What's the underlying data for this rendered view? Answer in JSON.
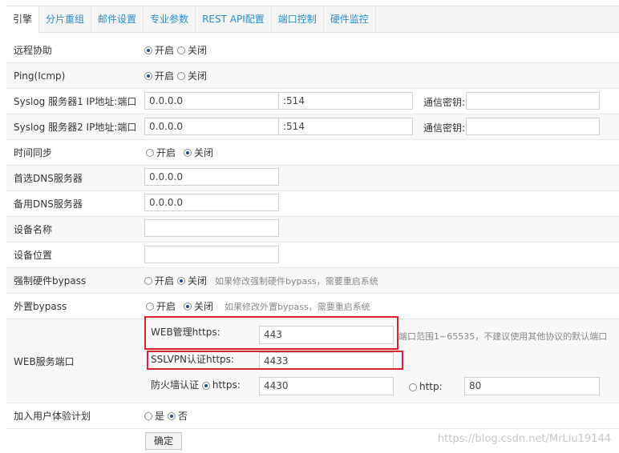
{
  "tabs": [
    "引擎",
    "分片重组",
    "邮件设置",
    "专业参数",
    "REST API配置",
    "端口控制",
    "硬件监控"
  ],
  "rows": {
    "remote_assist": {
      "label": "远程协助",
      "on": "开启",
      "off": "关闭"
    },
    "ping": {
      "label": "Ping(Icmp)",
      "on": "开启",
      "off": "关闭"
    },
    "syslog1": {
      "label": "Syslog 服务器1 IP地址:端口",
      "ip": "0.0.0.0",
      "port": "514",
      "secret_label": "通信密钥:"
    },
    "syslog2": {
      "label": "Syslog 服务器2 IP地址:端口",
      "ip": "0.0.0.0",
      "port": "514",
      "secret_label": "通信密钥:"
    },
    "time_sync": {
      "label": "时间同步",
      "on": "开启",
      "off": "关闭"
    },
    "dns1": {
      "label": "首选DNS服务器",
      "value": "0.0.0.0"
    },
    "dns2": {
      "label": "备用DNS服务器",
      "value": "0.0.0.0"
    },
    "device_name": {
      "label": "设备名称",
      "value": ""
    },
    "device_location": {
      "label": "设备位置",
      "value": ""
    },
    "hw_bypass": {
      "label": "强制硬件bypass",
      "on": "开启",
      "off": "关闭",
      "hint": "如果修改强制硬件bypass，需要重启系统"
    },
    "ext_bypass": {
      "label": "外置bypass",
      "on": "开启",
      "off": "关闭",
      "hint": "如果修改外置bypass，需要重启系统"
    },
    "web_port": {
      "label": "WEB服务端口",
      "https_label": "WEB管理https:",
      "https_value": "443",
      "hint": "端口范围1~65535，不建议使用其他协议的默认端口",
      "sslvpn_label": "SSLVPN认证https:",
      "sslvpn_value": "4433",
      "fw_label": "防火墙认证",
      "fw_https": "https:",
      "fw_https_value": "4430",
      "fw_http": "http:",
      "fw_http_value": "80"
    },
    "ux_plan": {
      "label": "加入用户体验计划",
      "yes": "是",
      "no": "否"
    }
  },
  "confirm_label": "确定",
  "watermark": "https://blog.csdn.net/MrLiu19144"
}
